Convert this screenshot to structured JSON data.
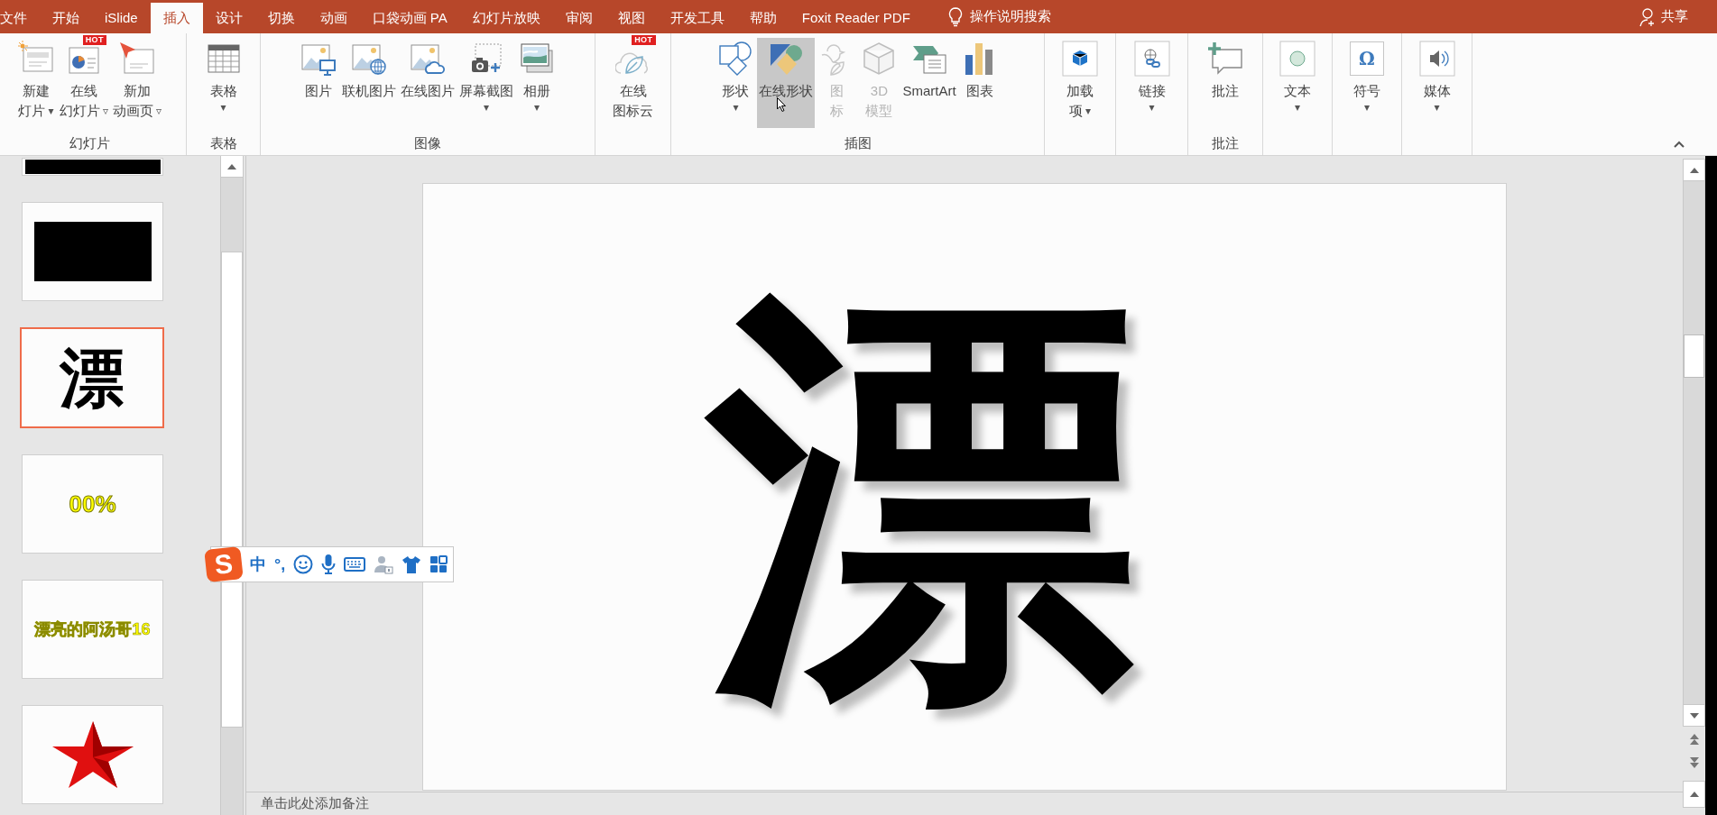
{
  "tabs": [
    {
      "label": "文件",
      "selected": false
    },
    {
      "label": "开始",
      "selected": false
    },
    {
      "label": "iSlide",
      "selected": false
    },
    {
      "label": "插入",
      "selected": true
    },
    {
      "label": "设计",
      "selected": false
    },
    {
      "label": "切换",
      "selected": false
    },
    {
      "label": "动画",
      "selected": false
    },
    {
      "label": "口袋动画 PA",
      "selected": false
    },
    {
      "label": "幻灯片放映",
      "selected": false
    },
    {
      "label": "审阅",
      "selected": false
    },
    {
      "label": "视图",
      "selected": false
    },
    {
      "label": "开发工具",
      "selected": false
    },
    {
      "label": "帮助",
      "selected": false
    },
    {
      "label": "Foxit Reader PDF",
      "selected": false
    }
  ],
  "tell_me": "操作说明搜索",
  "share": "共享",
  "ribbon": {
    "groups": [
      {
        "label": "幻灯片",
        "buttons": [
          {
            "lines": [
              "新建",
              "灯片"
            ],
            "arrow": "▾",
            "disabled": false,
            "hovered": false
          },
          {
            "lines": [
              "在线",
              "幻灯片"
            ],
            "arrow": "▿",
            "badge": "HOT",
            "disabled": false,
            "hovered": false
          },
          {
            "lines": [
              "新加",
              "动画页"
            ],
            "arrow": "▿",
            "disabled": false,
            "hovered": false
          }
        ]
      },
      {
        "label": "表格",
        "buttons": [
          {
            "lines": [
              "表格"
            ],
            "arrow_below": "▾",
            "disabled": false,
            "hovered": false
          }
        ]
      },
      {
        "label": "图像",
        "buttons": [
          {
            "lines": [
              "图片"
            ],
            "disabled": false,
            "hovered": false
          },
          {
            "lines": [
              "联机图片"
            ],
            "disabled": false,
            "hovered": false
          },
          {
            "lines": [
              "在线图片"
            ],
            "disabled": false,
            "hovered": false
          },
          {
            "lines": [
              "屏幕截图"
            ],
            "arrow_below": "▾",
            "disabled": false,
            "hovered": false
          },
          {
            "lines": [
              "相册"
            ],
            "arrow_below": "▾",
            "disabled": false,
            "hovered": false
          }
        ]
      },
      {
        "buttons": [
          {
            "lines": [
              "在线",
              "图标云"
            ],
            "badge": "HOT",
            "disabled": false,
            "hovered": false
          }
        ]
      },
      {
        "label": "插图",
        "buttons": [
          {
            "lines": [
              "形状"
            ],
            "arrow_below": "▾",
            "disabled": false,
            "hovered": false
          },
          {
            "lines": [
              "在线形状"
            ],
            "disabled": false,
            "hovered": true
          },
          {
            "lines": [
              "图",
              "标"
            ],
            "disabled": true,
            "hovered": false
          },
          {
            "lines": [
              "3D",
              "模型"
            ],
            "disabled": true,
            "hovered": false
          },
          {
            "lines": [
              "SmartArt"
            ],
            "disabled": false,
            "hovered": false
          },
          {
            "lines": [
              "图表"
            ],
            "disabled": false,
            "hovered": false
          }
        ]
      },
      {
        "buttons": [
          {
            "lines": [
              "加载",
              "项"
            ],
            "arrow": "▾",
            "disabled": false,
            "hovered": false
          }
        ]
      },
      {
        "buttons": [
          {
            "lines": [
              "链接"
            ],
            "arrow_below": "▾",
            "disabled": false,
            "hovered": false
          }
        ]
      },
      {
        "label": "批注",
        "buttons": [
          {
            "lines": [
              "批注"
            ],
            "disabled": false,
            "hovered": false
          }
        ]
      },
      {
        "buttons": [
          {
            "lines": [
              "文本"
            ],
            "arrow_below": "▾",
            "disabled": false,
            "hovered": false
          }
        ]
      },
      {
        "buttons": [
          {
            "lines": [
              "符号"
            ],
            "arrow_below": "▾",
            "glyph": "Ω",
            "disabled": false,
            "hovered": false
          }
        ]
      },
      {
        "buttons": [
          {
            "lines": [
              "媒体"
            ],
            "arrow_below": "▾",
            "disabled": false,
            "hovered": false
          }
        ]
      }
    ]
  },
  "slides": [
    {
      "kind": "black_bar",
      "selected": false
    },
    {
      "kind": "black_rect",
      "selected": false
    },
    {
      "kind": "big_char",
      "text": "漂",
      "selected": true
    },
    {
      "kind": "yellow_bold",
      "text": "00%",
      "selected": false
    },
    {
      "kind": "yellow_outline",
      "text": "漂亮的阿汤哥16",
      "selected": false
    },
    {
      "kind": "star",
      "selected": false
    }
  ],
  "slide": {
    "text": "漂"
  },
  "notes": {
    "placeholder": "单击此处添加备注"
  },
  "ime": {
    "logo": "S",
    "mode": "中",
    "punct": "°,"
  }
}
